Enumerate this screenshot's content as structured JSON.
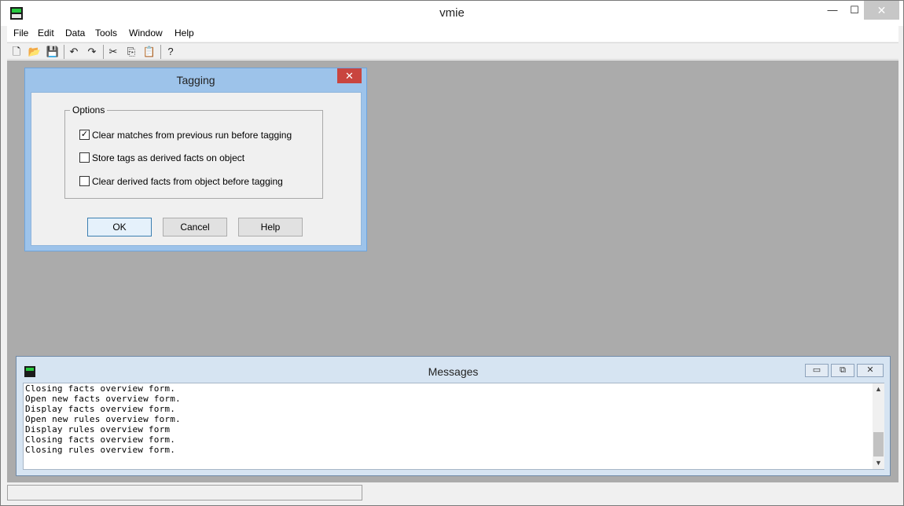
{
  "app": {
    "title": "vmie",
    "window_buttons": {
      "minimize": "—",
      "maximize": "☐",
      "close": "✕"
    }
  },
  "menu": [
    "File",
    "Edit",
    "Data",
    "Tools",
    "Window",
    "Help"
  ],
  "toolbar": {
    "icons": [
      "new-file-icon",
      "open-folder-icon",
      "save-icon",
      "undo-icon",
      "redo-icon",
      "cut-icon",
      "copy-icon",
      "paste-icon",
      "help-icon"
    ],
    "glyphs": {
      "new": "🗋",
      "open": "📂",
      "save": "💾",
      "undo": "↶",
      "redo": "↷",
      "cut": "✂",
      "copy": "⎘",
      "paste": "📋",
      "help": "?"
    }
  },
  "dialog": {
    "title": "Tagging",
    "close": "✕",
    "group_label": "Options",
    "options": [
      {
        "label": "Clear matches from previous run before tagging",
        "checked": true,
        "mark": "✓"
      },
      {
        "label": "Store tags as derived facts on object",
        "checked": false,
        "mark": ""
      },
      {
        "label": "Clear derived facts from object before tagging",
        "checked": false,
        "mark": ""
      }
    ],
    "buttons": {
      "ok": "OK",
      "cancel": "Cancel",
      "help": "Help"
    }
  },
  "messages": {
    "title": "Messages",
    "window_buttons": {
      "minimize": "▭",
      "restore": "⧉",
      "close": "✕"
    },
    "lines": [
      "Closing facts overview form.",
      "Open new facts overview form.",
      "Display facts overview form.",
      "Open new rules overview form.",
      "Display rules overview form",
      "Closing facts overview form.",
      "Closing rules overview form."
    ],
    "scroll_up": "▲",
    "scroll_down": "▼"
  }
}
